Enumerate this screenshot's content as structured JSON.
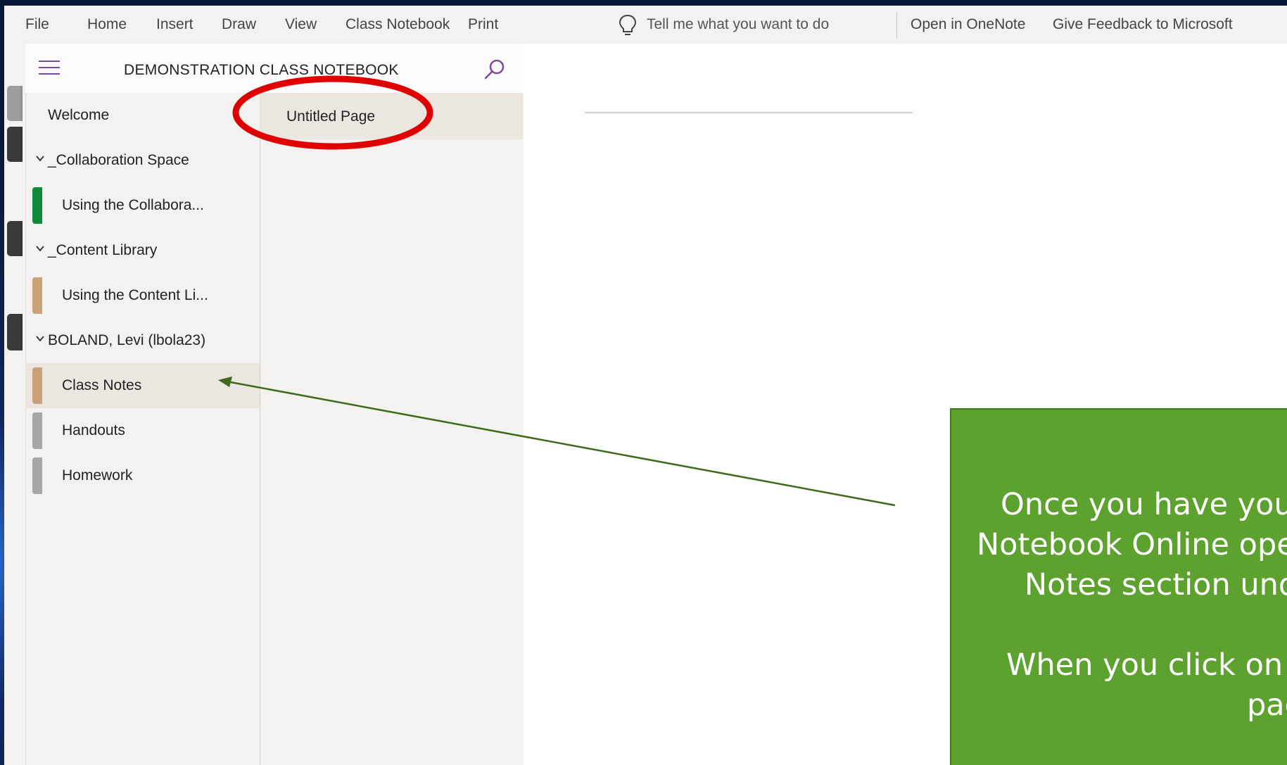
{
  "ribbon": {
    "menu": [
      "File",
      "Home",
      "Insert",
      "Draw",
      "View",
      "Class Notebook",
      "Print"
    ],
    "tell_me": "Tell me what you want to do",
    "open_in_onenote": "Open in OneNote",
    "feedback": "Give Feedback to Microsoft"
  },
  "notebook": {
    "title": "DEMONSTRATION CLASS NOTEBOOK"
  },
  "sections": [
    {
      "label": "Welcome",
      "type": "section",
      "color": "#a6a6a6"
    },
    {
      "label": "_Collaboration Space",
      "type": "group",
      "expanded": true
    },
    {
      "label": "Using the Collabora...",
      "type": "section",
      "color": "#0e8a3a"
    },
    {
      "label": "_Content Library",
      "type": "group",
      "expanded": true
    },
    {
      "label": "Using the Content Li...",
      "type": "section",
      "color": "#c9a27a"
    },
    {
      "label": "BOLAND, Levi (lbola23)",
      "type": "group",
      "expanded": true
    },
    {
      "label": "Class Notes",
      "type": "section",
      "color": "#c9a27a",
      "selected": true
    },
    {
      "label": "Handouts",
      "type": "section",
      "color": "#a6a6a6"
    },
    {
      "label": "Homework",
      "type": "section",
      "color": "#a6a6a6"
    }
  ],
  "pages": [
    {
      "label": "Untitled Page",
      "selected": true
    }
  ],
  "callout": {
    "lines": [
      "Once you have your l",
      "Notebook Online open",
      "Notes section unde",
      "",
      "When you click on it,",
      "pag"
    ],
    "color": "#5da22f"
  },
  "colors": {
    "accent_purple": "#7e4a9e",
    "highlight_red": "#e00000",
    "arrow_green": "#3d6b1a"
  }
}
